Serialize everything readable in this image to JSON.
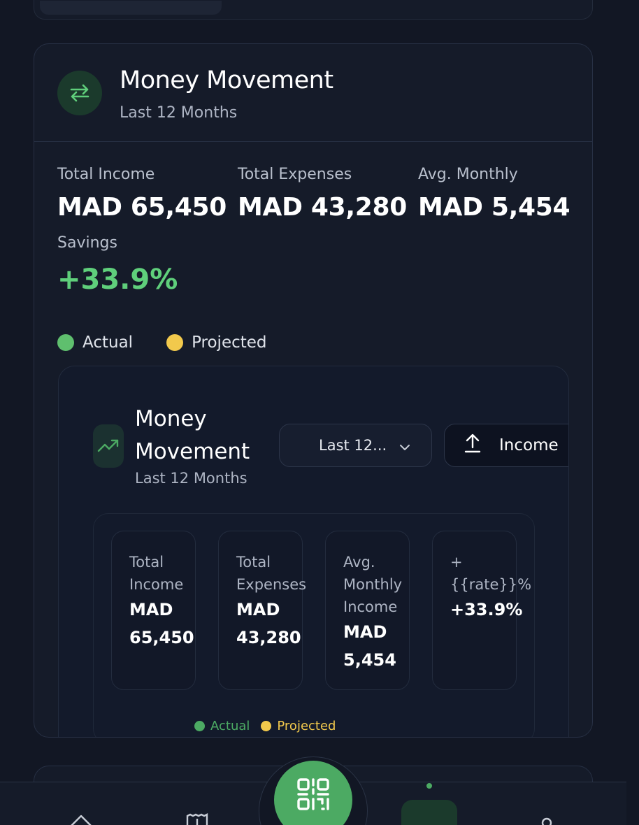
{
  "colors": {
    "accent_green": "#5fcf7b",
    "actual_dot": "#5fbf6e",
    "projected_dot": "#f2c94c",
    "background": "#121724",
    "card": "#151b29"
  },
  "header": {
    "icon": "swap-arrows-icon",
    "title": "Money Movement",
    "subtitle": "Last 12 Months"
  },
  "stats": [
    {
      "label": "Total Income",
      "value": "MAD 65,450"
    },
    {
      "label": "Total Expenses",
      "value": "MAD 43,280"
    },
    {
      "label": "Avg. Monthly",
      "value": "MAD 5,454"
    }
  ],
  "savings": {
    "label": "Savings",
    "value": "+33.9%"
  },
  "legend": {
    "actual": "Actual",
    "projected": "Projected"
  },
  "inner": {
    "icon": "trending-up-icon",
    "title": "Money Movement",
    "subtitle": "Last 12 Months",
    "period_select": {
      "value": "Last 12...",
      "icon": "chevron-down-icon"
    },
    "income_button": {
      "label": "Income",
      "icon": "upload-icon"
    },
    "kpis": [
      {
        "label": "Total Income",
        "value": "MAD\n65,450"
      },
      {
        "label": "Total Expenses",
        "value": "MAD\n43,280"
      },
      {
        "label": "Avg. Monthly Income",
        "value": "MAD\n5,454"
      },
      {
        "label": "+ {{rate}}%",
        "value": "+33.9%"
      }
    ],
    "legend": {
      "actual": "Actual",
      "projected": "Projected"
    }
  },
  "bottom_nav": {
    "items": [
      "home-icon",
      "receipt-icon",
      "qr-code-icon",
      "analytics-icon",
      "profile-icon"
    ],
    "active": "analytics-icon"
  }
}
